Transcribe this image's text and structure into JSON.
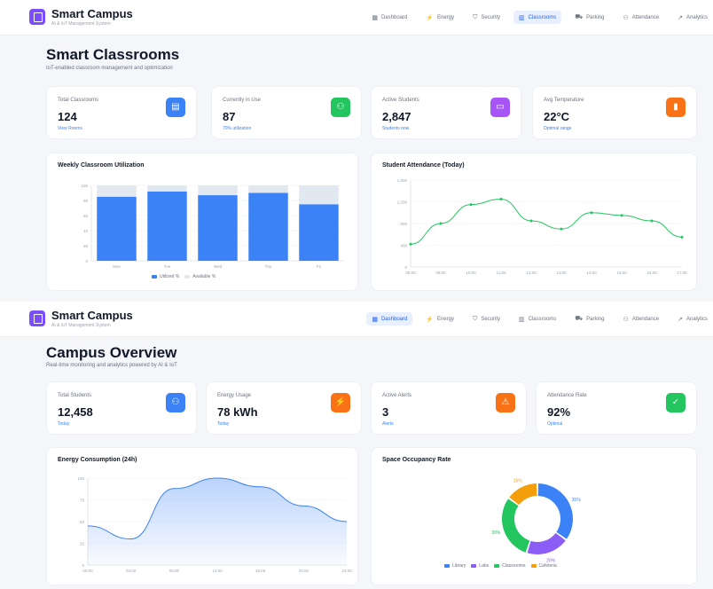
{
  "top": {
    "brand": "Smart Campus",
    "brand_sub": "AI & IoT Management System",
    "nav": [
      {
        "label": "Dashboard",
        "icon": "▦",
        "active": false
      },
      {
        "label": "Energy",
        "icon": "⚡",
        "active": false
      },
      {
        "label": "Security",
        "icon": "⛉",
        "active": false
      },
      {
        "label": "Classrooms",
        "icon": "▥",
        "active": true
      },
      {
        "label": "Parking",
        "icon": "⛟",
        "active": false
      },
      {
        "label": "Attendance",
        "icon": "⚇",
        "active": false
      },
      {
        "label": "Analytics",
        "icon": "↗",
        "active": false
      }
    ],
    "title": "Smart Classrooms",
    "subtitle": "IoT-enabled classroom management and optimization",
    "stats": [
      {
        "label": "Total Classrooms",
        "value": "124",
        "note": "View Rooms",
        "icon": "▤",
        "color": "#3b82f6"
      },
      {
        "label": "Currently in Use",
        "value": "87",
        "note": "70% utilization",
        "icon": "⚇",
        "color": "#22c55e"
      },
      {
        "label": "Active Students",
        "value": "2,847",
        "note": "Students now",
        "icon": "▭",
        "color": "#a855f7"
      },
      {
        "label": "Avg Temperature",
        "value": "22°C",
        "note": "Optimal range",
        "icon": "▮",
        "color": "#f97316"
      }
    ],
    "bar_chart": {
      "title": "Weekly Classroom Utilization",
      "legend": [
        "Utilized %",
        "Available %"
      ],
      "chart_data": {
        "type": "bar",
        "categories": [
          "Mon",
          "Tue",
          "Wed",
          "Thu",
          "Fri"
        ],
        "series": [
          {
            "name": "Utilized %",
            "values": [
              85,
              92,
              87,
              90,
              75
            ],
            "color": "#3b82f6"
          },
          {
            "name": "Available %",
            "values": [
              15,
              8,
              13,
              10,
              25
            ],
            "color": "#e2e8f0"
          }
        ],
        "yticks": [
          "0",
          "20",
          "40",
          "60",
          "80",
          "100"
        ],
        "ylim": [
          0,
          100
        ],
        "stacked": true
      }
    },
    "line_chart": {
      "title": "Student Attendance (Today)",
      "chart_data": {
        "type": "line",
        "x": [
          "08:00",
          "09:00",
          "10:00",
          "11:00",
          "12:00",
          "13:00",
          "14:00",
          "15:00",
          "16:00",
          "17:00"
        ],
        "values": [
          420,
          800,
          1150,
          1250,
          850,
          700,
          1000,
          950,
          850,
          550
        ],
        "yticks": [
          "0",
          "400",
          "800",
          "1,200",
          "1,600"
        ],
        "ylim": [
          0,
          1600
        ],
        "color": "#22c55e"
      }
    }
  },
  "bottom": {
    "brand": "Smart Campus",
    "brand_sub": "AI & IoT Management System",
    "nav": [
      {
        "label": "Dashboard",
        "icon": "▦",
        "active": true
      },
      {
        "label": "Energy",
        "icon": "⚡",
        "active": false
      },
      {
        "label": "Security",
        "icon": "⛉",
        "active": false
      },
      {
        "label": "Classrooms",
        "icon": "▥",
        "active": false
      },
      {
        "label": "Parking",
        "icon": "⛟",
        "active": false
      },
      {
        "label": "Attendance",
        "icon": "⚇",
        "active": false
      },
      {
        "label": "Analytics",
        "icon": "↗",
        "active": false
      }
    ],
    "title": "Campus Overview",
    "subtitle": "Real-time monitoring and analytics powered by AI & IoT",
    "stats": [
      {
        "label": "Total Students",
        "value": "12,458",
        "note": "Today",
        "icon": "⚇",
        "color": "#3b82f6"
      },
      {
        "label": "Energy Usage",
        "value": "78 kWh",
        "note": "Today",
        "icon": "⚡",
        "color": "#f97316"
      },
      {
        "label": "Active Alerts",
        "value": "3",
        "note": "Alerts",
        "icon": "⚠",
        "color": "#f97316"
      },
      {
        "label": "Attendance Rate",
        "value": "92%",
        "note": "Optimal",
        "icon": "✓",
        "color": "#22c55e"
      }
    ],
    "area_chart": {
      "title": "Energy Consumption (24h)",
      "chart_data": {
        "type": "area",
        "x": [
          "00:00",
          "04:00",
          "08:00",
          "12:00",
          "16:00",
          "20:00",
          "24:00"
        ],
        "values": [
          45,
          30,
          88,
          100,
          90,
          68,
          50
        ],
        "yticks": [
          "0",
          "25",
          "50",
          "75",
          "100"
        ],
        "ylim": [
          0,
          100
        ],
        "color": "#3b82f6"
      }
    },
    "donut_chart": {
      "title": "Space Occupancy Rate",
      "chart_data": {
        "type": "pie",
        "labels": [
          "Library",
          "Labs",
          "Classrooms",
          "Cafeteria"
        ],
        "values": [
          35,
          20,
          30,
          15
        ],
        "value_labels": [
          "35%",
          "20%",
          "30%",
          "15%"
        ],
        "colors": [
          "#3b82f6",
          "#8b5cf6",
          "#22c55e",
          "#f59e0b"
        ]
      }
    }
  }
}
